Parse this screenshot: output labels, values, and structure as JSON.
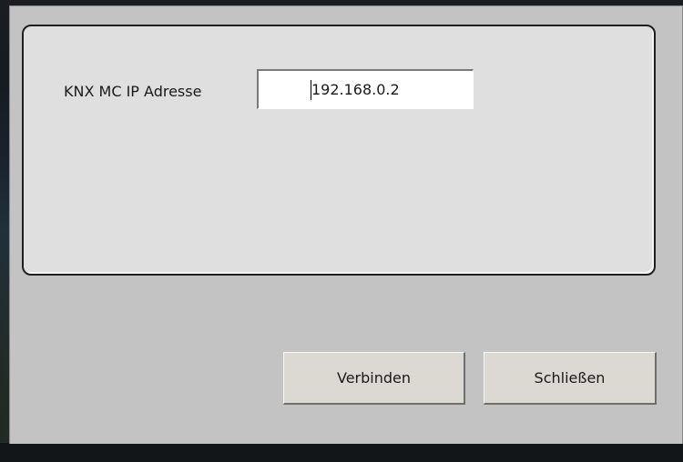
{
  "form": {
    "ip_label": "KNX MC IP Adresse",
    "ip_value": "192.168.0.2"
  },
  "buttons": {
    "connect_label": "Verbinden",
    "close_label": "Schließen"
  }
}
